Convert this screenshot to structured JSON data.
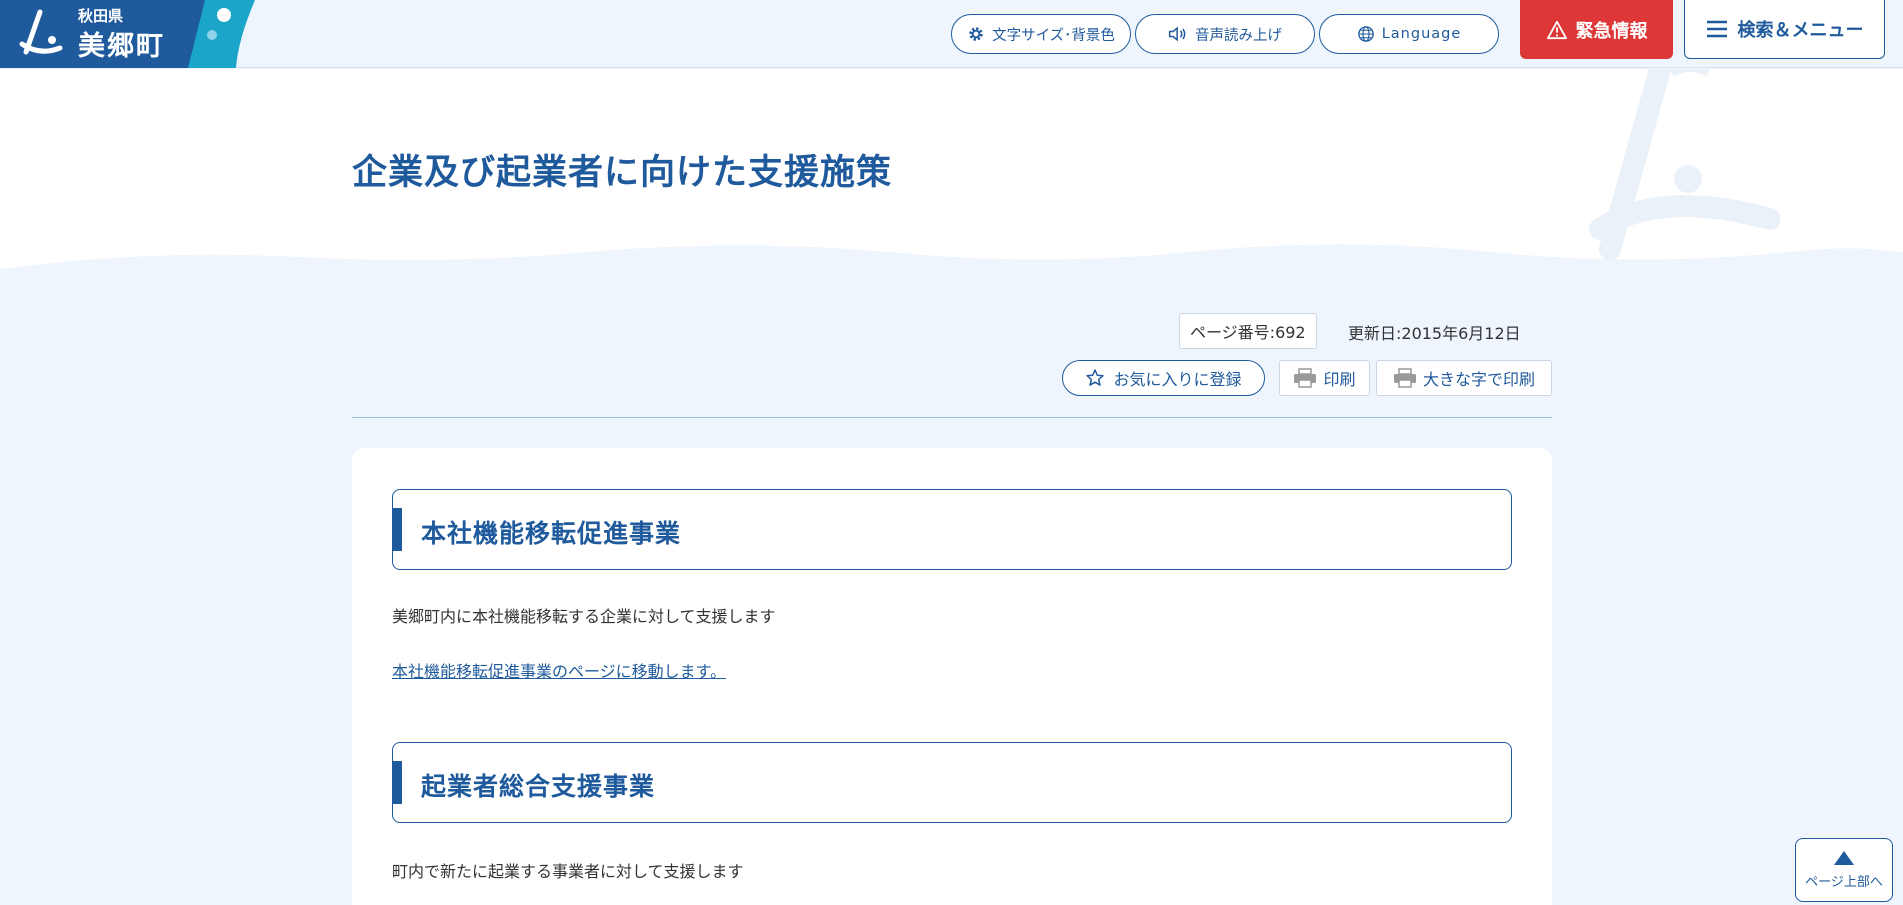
{
  "header": {
    "prefecture": "秋田県",
    "town": "美郷町",
    "font_bg_label": "文字サイズ･背景色",
    "voice_label": "音声読み上げ",
    "language_label": "Language",
    "emergency_label": "緊急情報",
    "menu_label": "検索＆メニュー"
  },
  "page": {
    "title": "企業及び起業者に向けた支援施策",
    "page_number": "ページ番号:692",
    "updated": "更新日:2015年6月12日",
    "favorite_label": "お気に入りに登録",
    "print_label": "印刷",
    "print_large_label": "大きな字で印刷"
  },
  "sections": [
    {
      "heading": "本社機能移転促進事業",
      "text": "美郷町内に本社機能移転する企業に対して支援します",
      "link": "本社機能移転促進事業のページに移動します。"
    },
    {
      "heading": "起業者総合支援事業",
      "text": "町内で新たに起業する事業者に対して支援します"
    }
  ],
  "page_top_label": "ページ上部へ",
  "colors": {
    "brand_blue": "#1f5a9c",
    "emergency_red": "#de3737",
    "background": "#eef5fc"
  }
}
